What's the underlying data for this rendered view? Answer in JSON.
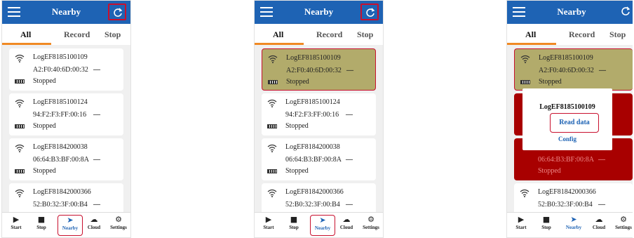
{
  "app": {
    "title": "Nearby"
  },
  "tabs": [
    {
      "label": "All"
    },
    {
      "label": "Record"
    },
    {
      "label": "Stop"
    }
  ],
  "devices": [
    {
      "name": "LogEF8185100109",
      "mac": "A2:F0:40:6D:00:32",
      "signal": "—",
      "status": "Stopped"
    },
    {
      "name": "LogEF8185100124",
      "mac": "94:F2:F3:FF:00:16",
      "signal": "—",
      "status": "Stopped"
    },
    {
      "name": "LogEF8184200038",
      "mac": "06:64:B3:BF:00:8A",
      "signal": "—",
      "status": "Stopped"
    },
    {
      "name": "LogEF81842000366",
      "mac": "52:B0:32:3F:00:B4",
      "signal": "—",
      "status": ""
    }
  ],
  "nav": [
    {
      "label": "Start",
      "icon": "play-icon"
    },
    {
      "label": "Stop",
      "icon": "stop-icon"
    },
    {
      "label": "Nearby",
      "icon": "compass-icon"
    },
    {
      "label": "Cloud",
      "icon": "cloud-icon"
    },
    {
      "label": "Settings",
      "icon": "gear-icon"
    }
  ],
  "popup": {
    "title": "LogEF8185100109",
    "primary": "Read data",
    "secondary": "Config"
  },
  "colors": {
    "header": "#1e63b4",
    "accent": "#f08a24",
    "highlight": "#c8102e",
    "selected": "#b2ab6b",
    "red_card": "#a80000"
  }
}
